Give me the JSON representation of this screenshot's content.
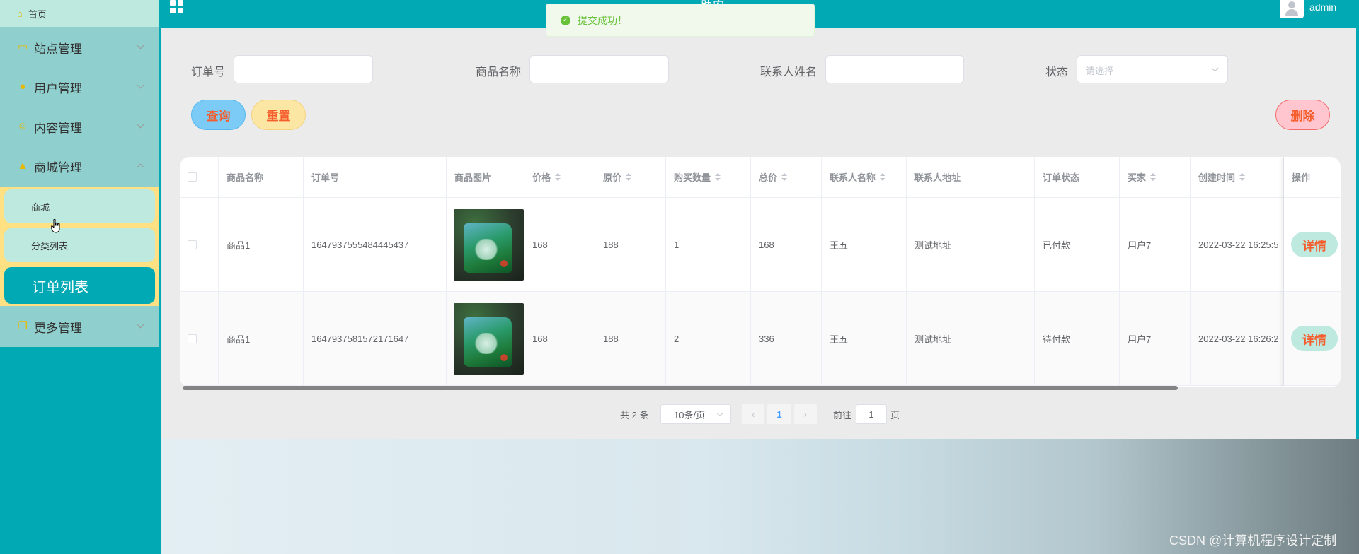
{
  "header": {
    "title_fragment": "助农",
    "username": "admin"
  },
  "toast": {
    "message": "提交成功！"
  },
  "sidebar": {
    "home": "首页",
    "items": [
      {
        "label": "站点管理",
        "icon": "display-icon"
      },
      {
        "label": "用户管理",
        "icon": "user-icon"
      },
      {
        "label": "内容管理",
        "icon": "message-icon"
      },
      {
        "label": "商城管理",
        "icon": "shop-bag-icon"
      }
    ],
    "sub_items": [
      "商城",
      "分类列表",
      "订单列表"
    ],
    "more": {
      "label": "更多管理",
      "icon": "copy-icon"
    }
  },
  "search": {
    "order_no_label": "订单号",
    "product_name_label": "商品名称",
    "contact_name_label": "联系人姓名",
    "status_label": "状态",
    "status_placeholder": "请选择",
    "query_btn": "查询",
    "reset_btn": "重置",
    "delete_btn": "删除"
  },
  "table": {
    "headers": [
      "商品名称",
      "订单号",
      "商品图片",
      "价格",
      "原价",
      "购买数量",
      "总价",
      "联系人名称",
      "联系人地址",
      "订单状态",
      "买家",
      "创建时间",
      "操作"
    ],
    "rows": [
      {
        "name": "商品1",
        "order_no": "1647937555484445437",
        "price": "168",
        "orig": "188",
        "qty": "1",
        "total": "168",
        "contact": "王五",
        "address": "测试地址",
        "status": "已付款",
        "buyer": "用户7",
        "created": "2022-03-22 16:25:5",
        "action": "详情"
      },
      {
        "name": "商品1",
        "order_no": "1647937581572171647",
        "price": "168",
        "orig": "188",
        "qty": "2",
        "total": "336",
        "contact": "王五",
        "address": "测试地址",
        "status": "待付款",
        "buyer": "用户7",
        "created": "2022-03-22 16:26:2",
        "action": "详情"
      }
    ]
  },
  "pagination": {
    "total": "共 2 条",
    "size": "10条/页",
    "current": "1",
    "goto": "前往",
    "page_input": "1",
    "page_unit": "页"
  },
  "watermark": "CSDN @计算机程序设计定制",
  "colors": {
    "primary": "#00a9b4",
    "sidebar": "#8fcfcd",
    "highlight": "#ffe083",
    "action_text": "#f55d2c",
    "success": "#67c23a"
  }
}
